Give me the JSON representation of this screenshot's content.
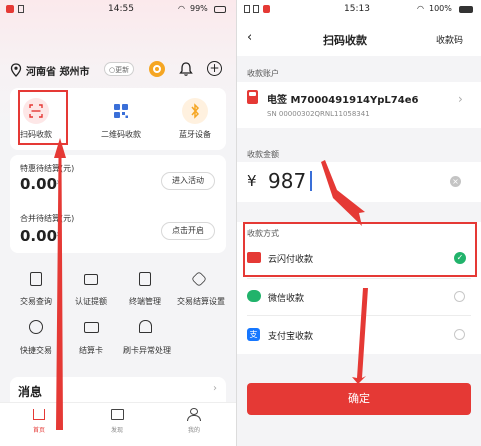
{
  "left": {
    "status_bar": {
      "time": "14:55",
      "battery": "99%"
    },
    "location": {
      "text": "河南省 郑州市",
      "update_label": "更新"
    },
    "quick_actions": [
      {
        "label": "扫码收款"
      },
      {
        "label": "二维码收款"
      },
      {
        "label": "蓝牙设备"
      }
    ],
    "settlement": {
      "pending_label": "特惠待结算(元)",
      "pending_value": "0.00",
      "pending_button": "进入活动",
      "merged_label": "合并待结算(元)",
      "merged_value": "0.00",
      "merged_button": "点击开启"
    },
    "tools": [
      {
        "label": "交易查询"
      },
      {
        "label": "认证提额"
      },
      {
        "label": "终端管理"
      },
      {
        "label": "交易结算设置"
      },
      {
        "label": "快捷交易"
      },
      {
        "label": "结算卡"
      },
      {
        "label": "刷卡异常处理"
      }
    ],
    "messages_title": "消息",
    "bottom_nav": [
      {
        "label": "首页"
      },
      {
        "label": "发现"
      },
      {
        "label": "我的"
      }
    ],
    "colors": {
      "accent_red": "#e53935",
      "brand_orange": "#f5a623"
    }
  },
  "right": {
    "status_bar": {
      "time": "15:13",
      "battery": "100%"
    },
    "header": {
      "title": "扫码收款",
      "right_action": "收款码"
    },
    "account": {
      "section_label": "收款账户",
      "name": "电签 M7000491914YpL74e6",
      "sn": "SN 00000302QRNL11058341"
    },
    "amount": {
      "section_label": "收款金额",
      "currency": "¥",
      "value": "987"
    },
    "methods": {
      "section_label": "收款方式",
      "items": [
        {
          "label": "云闪付收款",
          "selected": true
        },
        {
          "label": "微信收款",
          "selected": false
        },
        {
          "label": "支付宝收款",
          "selected": false
        }
      ]
    },
    "confirm_label": "确定",
    "colors": {
      "accent_red": "#e53935",
      "check_green": "#21b36b"
    }
  }
}
